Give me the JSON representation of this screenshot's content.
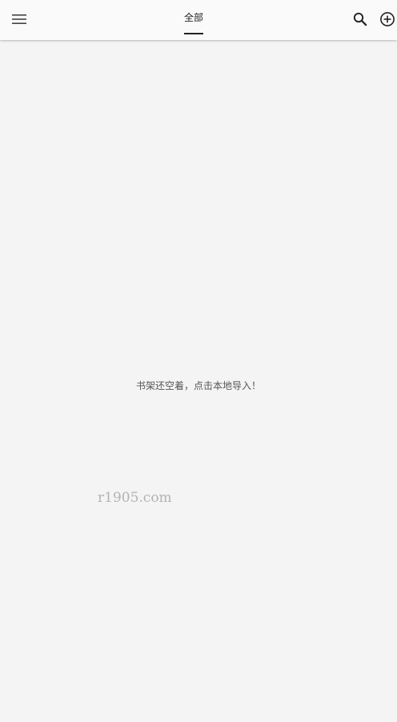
{
  "header": {
    "menu_icon": "hamburger-menu-icon",
    "tab_label": "全部",
    "search_icon": "search-icon",
    "add_icon": "add-circle-icon"
  },
  "main": {
    "empty_message": "书架还空着，点击本地导入！"
  },
  "watermark": {
    "text": "r1905.com"
  },
  "colors": {
    "background": "#f4f4f4",
    "app_bar": "#fafafa",
    "text_primary": "#222222",
    "text_secondary": "#555555"
  }
}
